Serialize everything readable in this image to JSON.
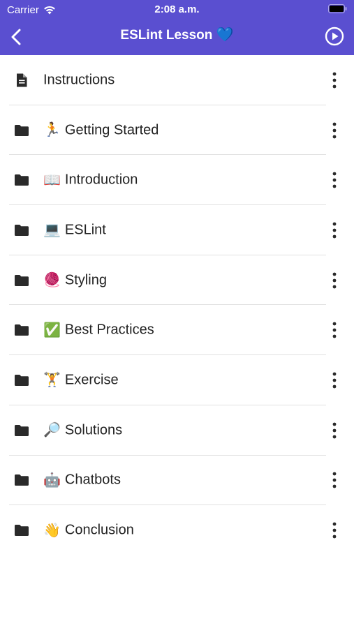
{
  "status_bar": {
    "carrier": "Carrier",
    "time": "2:08 a.m."
  },
  "nav": {
    "title": "ESLint Lesson",
    "title_emoji": "💙",
    "back_icon": "chevron-left-icon",
    "play_icon": "play-circle-icon"
  },
  "colors": {
    "header": "#5a4fd0",
    "text": "#222222",
    "separator": "#e1e1e1"
  },
  "items": [
    {
      "type": "document",
      "emoji": "",
      "label": "Instructions"
    },
    {
      "type": "folder",
      "emoji": "🏃",
      "label": "Getting Started"
    },
    {
      "type": "folder",
      "emoji": "📖",
      "label": "Introduction"
    },
    {
      "type": "folder",
      "emoji": "💻",
      "label": "ESLint"
    },
    {
      "type": "folder",
      "emoji": "🧶",
      "label": "Styling"
    },
    {
      "type": "folder",
      "emoji": "✅",
      "label": "Best Practices"
    },
    {
      "type": "folder",
      "emoji": "🏋",
      "label": "Exercise"
    },
    {
      "type": "folder",
      "emoji": "🔎",
      "label": "Solutions"
    },
    {
      "type": "folder",
      "emoji": "🤖",
      "label": "Chatbots"
    },
    {
      "type": "folder",
      "emoji": "👋",
      "label": "Conclusion"
    }
  ]
}
